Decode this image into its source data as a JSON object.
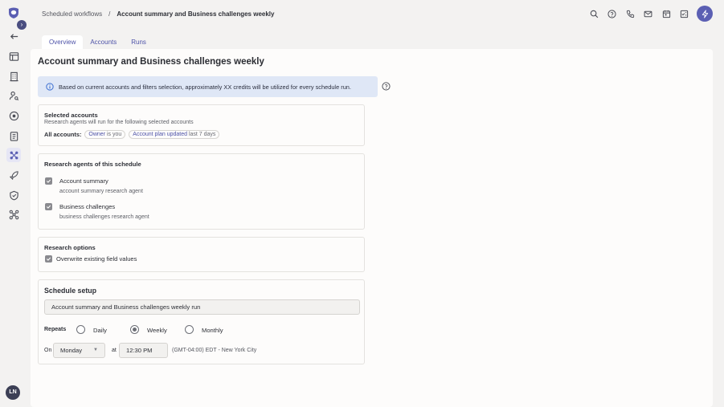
{
  "breadcrumb": {
    "parent": "Scheduled workflows",
    "separator": "/",
    "current": "Account summary and Business challenges weekly"
  },
  "sidebar": {
    "icons": [
      "back-arrow-icon",
      "layout-icon",
      "building-icon",
      "user-search-icon",
      "eye-icon",
      "clipboard-icon",
      "workflow-icon",
      "rocket-icon",
      "shield-icon",
      "network-icon"
    ],
    "avatar_initials": "LN"
  },
  "header_icons": [
    "search-icon",
    "help-icon",
    "phone-icon",
    "mail-icon",
    "calendar-icon",
    "checklist-icon",
    "bolt-icon"
  ],
  "tabs": [
    {
      "label": "Overview",
      "active": true
    },
    {
      "label": "Accounts",
      "active": false
    },
    {
      "label": "Runs",
      "active": false
    }
  ],
  "page": {
    "title": "Account summary and Business challenges weekly",
    "info_text": "Based on current accounts and filters selection, approximately XX credits will be utilized for every schedule run."
  },
  "selected_accounts": {
    "title": "Selected accounts",
    "subtitle": "Research agents will run for the following selected accounts",
    "all_label": "All accounts:",
    "chip1_key": "Owner",
    "chip1_value": "is you",
    "chip2_key": "Account plan updated",
    "chip2_value": "last 7 days"
  },
  "research_agents": {
    "title": "Research agents of this schedule",
    "agents": [
      {
        "name": "Account summary",
        "desc": "account summary research agent",
        "checked": true
      },
      {
        "name": "Business challenges",
        "desc": "business challenges research agent",
        "checked": true
      }
    ]
  },
  "research_options": {
    "title": "Research options",
    "overwrite_label": "Overwrite existing field values",
    "overwrite_checked": true
  },
  "schedule": {
    "title": "Schedule setup",
    "name_value": "Account summary and Business challenges weekly run",
    "repeats_label": "Repeats",
    "options": [
      "Daily",
      "Weekly",
      "Monthly"
    ],
    "selected": "Weekly",
    "on_label": "On",
    "day_value": "Monday",
    "at_label": "at",
    "time_value": "12:30 PM",
    "timezone": "(GMT-04:00) EDT - New York City"
  },
  "colors": {
    "accent": "#5b5fb3",
    "tab_text": "#4d52a8",
    "banner_bg": "#dfe7f6"
  }
}
